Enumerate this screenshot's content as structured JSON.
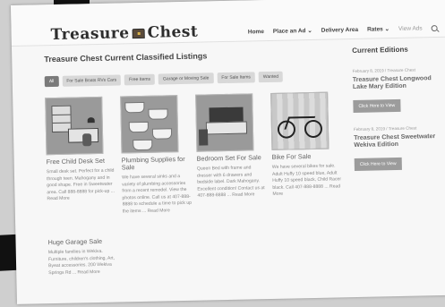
{
  "site": {
    "logo_left": "Treasure",
    "logo_right": "Chest"
  },
  "nav": {
    "items": [
      {
        "label": "Home",
        "muted": false
      },
      {
        "label": "Place an Ad ⌄",
        "muted": false
      },
      {
        "label": "Delivery Area",
        "muted": false
      },
      {
        "label": "Rates ⌄",
        "muted": false
      },
      {
        "label": "View Ads",
        "muted": true
      }
    ],
    "search_icon": "search-icon"
  },
  "main": {
    "title": "Treasure Chest Current Classified Listings",
    "filters": [
      {
        "label": "All",
        "active": true
      },
      {
        "label": "For Sale Boats RVs Cars",
        "active": false
      },
      {
        "label": "Free Items",
        "active": false
      },
      {
        "label": "Garage or Moving Sale",
        "active": false
      },
      {
        "label": "For Sale Items",
        "active": false
      },
      {
        "label": "Wanted",
        "active": false
      }
    ],
    "listings": [
      {
        "title": "Free Child Desk Set",
        "desc": "Small desk set. Perfect for a child through teen. Mahogany and in good shape. Free in Sweetwater area. Call 888-8888 for pick-up ... Read More",
        "image": "desk-set"
      },
      {
        "title": "Plumbing Supplies for Sale",
        "desc": "We have several sinks and a variety of plumbing accessories from a recent remodel. View the photos online. Call us at 407-888-8888 to schedule a time to pick up the items ... Read More",
        "image": "sinks"
      },
      {
        "title": "Bedroom Set For Sale",
        "desc": "Queen Bed with frame and dresser with 6 drawers and bedside label. Dark Mahogany. Excellent condition! Contact us at 407-888-8888 ... Read More",
        "image": "bedroom"
      },
      {
        "title": "Bike For Sale",
        "desc": "We have several bikes for sale. Adult Huffy 10 speed blue, Adult Huffy 10 speed black, Child Racer black. Call 407-888-8888 ... Read More",
        "image": "bike"
      },
      {
        "title": "Huge Garage Sale",
        "desc": "Multiple families in Wekiva. Furniture, children's clothing, Art, Byeat accessories. 200 Wekiva Springs Rd ... Read More",
        "image": ""
      }
    ]
  },
  "sidebar": {
    "title": "Current Editions",
    "posts": [
      {
        "meta": "February 8, 2019 / Treasure Chest",
        "title": "Treasure Chest Longwood Lake Mary Edition",
        "button": "Click Here to View"
      },
      {
        "meta": "February 8, 2019 / Treasure Chest",
        "title": "Treasure Chest Sweetwater Wekiva Edition",
        "button": "Click Here to View"
      }
    ]
  }
}
